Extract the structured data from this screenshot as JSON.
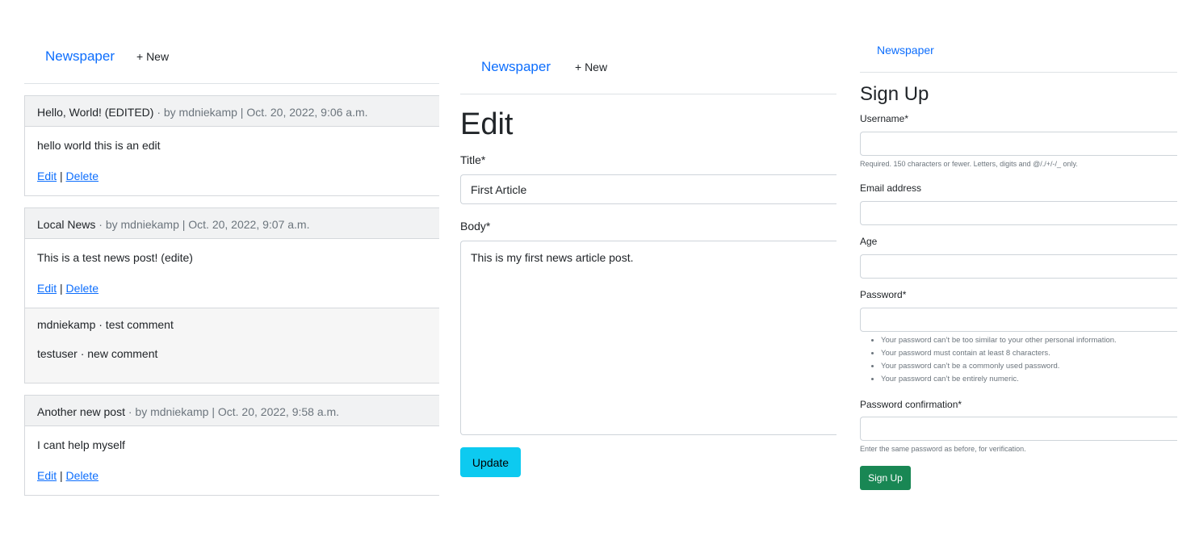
{
  "list_page": {
    "nav": {
      "brand": "Newspaper",
      "new_link": "+ New"
    },
    "articles": [
      {
        "title": "Hello, World! (EDITED)",
        "meta": "· by mdniekamp | Oct. 20, 2022, 9:06 a.m.",
        "body": "hello world this is an edit",
        "edit_label": "Edit",
        "separator": "|",
        "delete_label": "Delete"
      },
      {
        "title": "Local News",
        "meta": "· by mdniekamp | Oct. 20, 2022, 9:07 a.m.",
        "body": "This is a test news post! (edite)",
        "edit_label": "Edit",
        "separator": "|",
        "delete_label": "Delete",
        "comments": [
          "mdniekamp · test comment",
          "testuser · new comment"
        ]
      },
      {
        "title": "Another new post",
        "meta": "· by mdniekamp | Oct. 20, 2022, 9:58 a.m.",
        "body": "I cant help myself",
        "edit_label": "Edit",
        "separator": "|",
        "delete_label": "Delete"
      }
    ]
  },
  "edit_page": {
    "nav": {
      "brand": "Newspaper",
      "new_link": "+ New"
    },
    "heading": "Edit",
    "title_label": "Title*",
    "title_value": "First Article",
    "body_label": "Body*",
    "body_value": "This is my first news article post.",
    "submit_label": "Update",
    "button_color": "#0dcaf0"
  },
  "signup_page": {
    "nav": {
      "brand": "Newspaper"
    },
    "heading": "Sign Up",
    "username_label": "Username*",
    "username_help": "Required. 150 characters or fewer. Letters, digits and @/./+/-/_ only.",
    "email_label": "Email address",
    "age_label": "Age",
    "password_label": "Password*",
    "password_rules": [
      "Your password can’t be too similar to your other personal information.",
      "Your password must contain at least 8 characters.",
      "Your password can’t be a commonly used password.",
      "Your password can’t be entirely numeric."
    ],
    "password_confirm_label": "Password confirmation*",
    "password_confirm_help": "Enter the same password as before, for verification.",
    "submit_label": "Sign Up",
    "button_color": "#198754"
  }
}
